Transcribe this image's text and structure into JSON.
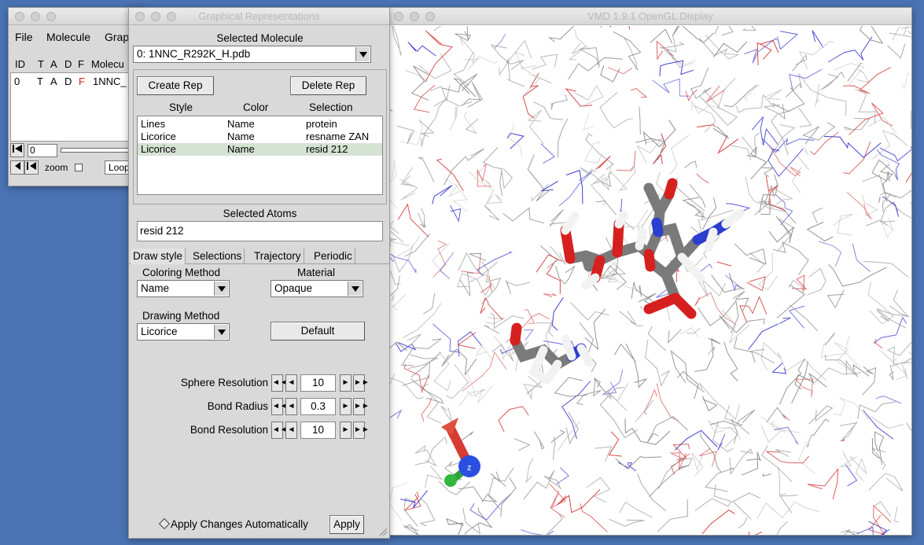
{
  "main_window": {
    "menu": {
      "file": "File",
      "molecule": "Molecule",
      "graphics": "Grap"
    },
    "columns": {
      "id": "ID",
      "t": "T",
      "a": "A",
      "d": "D",
      "f": "F",
      "molecule": "Molecu"
    },
    "row": {
      "id": "0",
      "t": "T",
      "a": "A",
      "d": "D",
      "f": "F",
      "molecule": "1NNC_"
    },
    "frame_value": "0",
    "zoom_label": "zoom",
    "loop_label": "Loop"
  },
  "graph_window": {
    "title": "Graphical Representations",
    "selected_molecule_label": "Selected Molecule",
    "selected_molecule_value": "0: 1NNC_R292K_H.pdb",
    "create_rep": "Create Rep",
    "delete_rep": "Delete Rep",
    "list_headers": {
      "style": "Style",
      "color": "Color",
      "selection": "Selection"
    },
    "reps": [
      {
        "style": "Lines",
        "color": "Name",
        "selection": "protein"
      },
      {
        "style": "Licorice",
        "color": "Name",
        "selection": "resname ZAN"
      },
      {
        "style": "Licorice",
        "color": "Name",
        "selection": "resid 212"
      }
    ],
    "selected_atoms_label": "Selected Atoms",
    "selected_atoms_value": "resid 212",
    "tabs": [
      "Draw style",
      "Selections",
      "Trajectory",
      "Periodic"
    ],
    "coloring_method_label": "Coloring Method",
    "coloring_method_value": "Name",
    "material_label": "Material",
    "material_value": "Opaque",
    "drawing_method_label": "Drawing Method",
    "drawing_method_value": "Licorice",
    "default_button": "Default",
    "sphere_resolution_label": "Sphere Resolution",
    "sphere_resolution_value": "10",
    "bond_radius_label": "Bond Radius",
    "bond_radius_value": "0.3",
    "bond_resolution_label": "Bond Resolution",
    "bond_resolution_value": "10",
    "apply_auto_label": "Apply Changes Automatically",
    "apply_button": "Apply"
  },
  "display_window": {
    "title": "VMD 1.9.1 OpenGL Display",
    "axis_label": "z"
  },
  "colors": {
    "desktop": "#4a73b3",
    "carbon": "#7a7a7a",
    "oxygen": "#d62020",
    "nitrogen": "#2a3fd0",
    "hydrogen": "#f2f2f2",
    "selected_row": "#d5e3d3"
  }
}
